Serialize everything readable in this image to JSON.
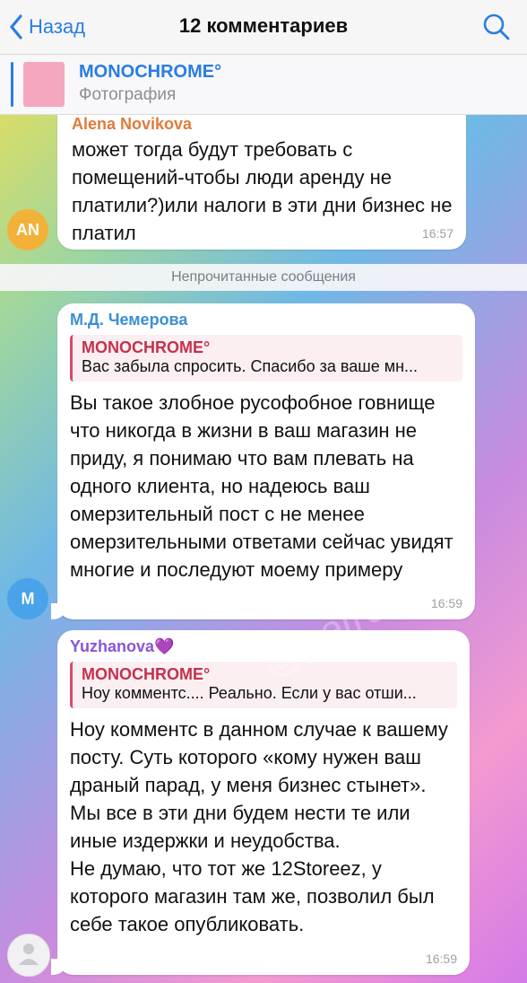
{
  "header": {
    "back_label": "Назад",
    "title": "12 комментариев"
  },
  "pinned": {
    "title": "MONOCHROME°",
    "subtitle": "Фотография"
  },
  "unread_label": "Непрочитанные сообщения",
  "watermark": "@petrovitel",
  "messages": [
    {
      "author": "Alena Novikova",
      "author_color": "#e07a3a",
      "avatar_initials": "AN",
      "avatar_color": "#f2b23a",
      "text": "может тогда будут требовать с помещений-чтобы люди аренду не платили?)или налоги в эти дни бизнес не платил",
      "time": "16:57"
    },
    {
      "author": "М.Д. Чемерова",
      "author_color": "#3b8fd4",
      "avatar_initials": "M",
      "avatar_color": "#4aa3e8",
      "reply_author": "MONOCHROME°",
      "reply_text": "Вас забыла спросить. Спасибо за ваше мн...",
      "text": "Вы такое злобное русофобное говнище что никогда в жизни в ваш магазин не приду, я понимаю что вам плевать на одного клиента, но надеюсь ваш омерзительный пост с не менее омерзительными ответами сейчас увидят многие и последуют моему примеру",
      "time": "16:59"
    },
    {
      "author": "Yuzhanova💜",
      "author_color": "#8a55d6",
      "reply_author": "MONOCHROME°",
      "reply_text": "Ноу комментс.... Реально. Если у вас отши...",
      "text": "Ноу комментс в данном случае к вашему посту. Суть которого «кому нужен ваш драный парад, у меня бизнес стынет».\nМы все в эти дни будем нести те или иные издержки и неудобства.\nНе думаю, что тот же 12Storeez, у которого магазин там же, позволил был себе такое опубликовать.",
      "time": "16:59"
    }
  ]
}
